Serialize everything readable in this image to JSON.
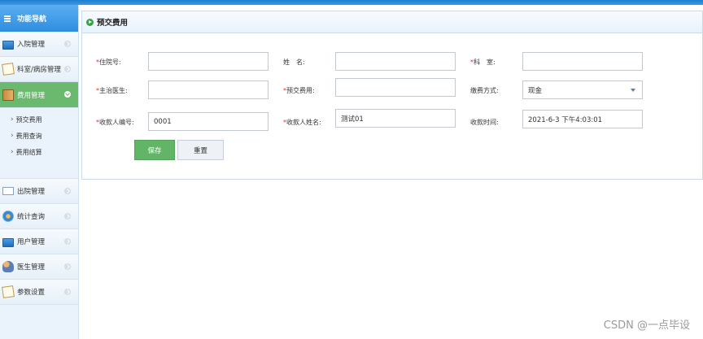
{
  "sidebar": {
    "header": "功能导航",
    "items": [
      {
        "label": "入院管理",
        "icon": "monitor-icon"
      },
      {
        "label": "科室/病房管理",
        "icon": "notepad-icon"
      },
      {
        "label": "费用管理",
        "icon": "book-icon",
        "active": true
      },
      {
        "label": "出院管理",
        "icon": "mail-icon"
      },
      {
        "label": "统计查询",
        "icon": "gear-icon"
      },
      {
        "label": "用户管理",
        "icon": "monitor-icon"
      },
      {
        "label": "医生管理",
        "icon": "users-icon"
      },
      {
        "label": "参数设置",
        "icon": "notepad-icon"
      }
    ],
    "subitems": [
      "预交费用",
      "费用查询",
      "费用结算"
    ]
  },
  "panel": {
    "title": "预交费用"
  },
  "form": {
    "inpatient_no_label": "住院号:",
    "name_label": "姓　名:",
    "dept_label": "科　室:",
    "doctor_label": "主治医生:",
    "prepaid_label": "预交费用:",
    "payment_label": "缴费方式:",
    "payment_value": "现金",
    "collector_no_label": "收款人编号:",
    "collector_no_value": "0001",
    "collector_name_label": "收款人姓名:",
    "collector_name_value": "测试01",
    "pay_time_label": "收款时间:",
    "pay_time_value": "2021-6-3 下午4:03:01",
    "required_mark": "*"
  },
  "buttons": {
    "save": "保存",
    "reset": "重置"
  },
  "watermark": "CSDN @一点毕设",
  "colors": {
    "accent": "#2f8ee0",
    "active_nav": "#6bb86f",
    "save_button": "#62b467",
    "required": "#e03030"
  }
}
